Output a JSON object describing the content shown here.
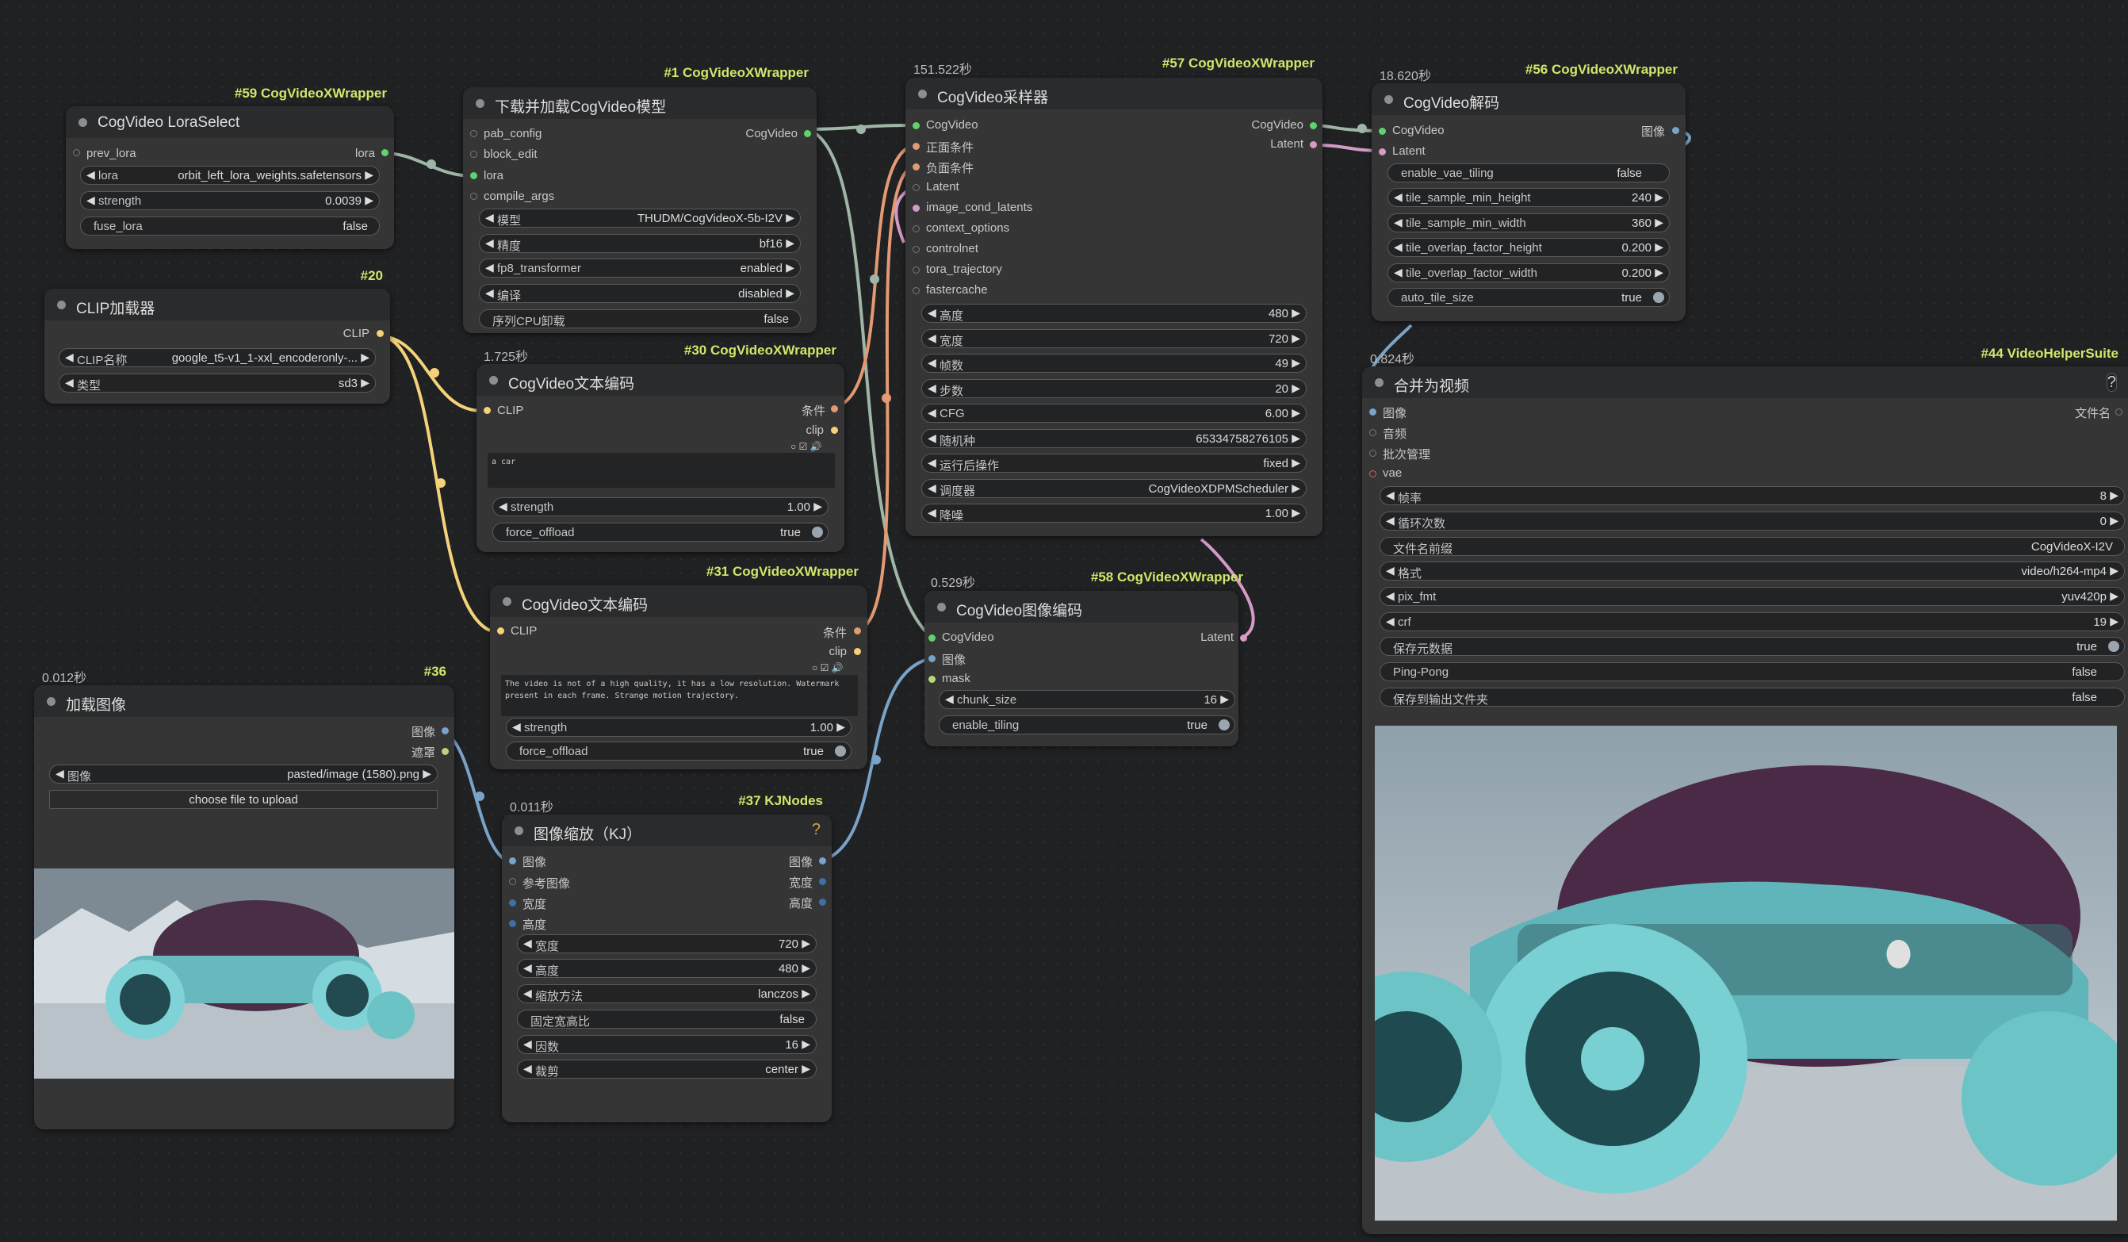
{
  "nodes": {
    "lora_select": {
      "tag": "#59 CogVideoXWrapper",
      "title": "CogVideo LoraSelect",
      "in_prev_lora": "prev_lora",
      "out_lora": "lora",
      "w_lora_label": "lora",
      "w_lora_value": "orbit_left_lora_weights.safetensors",
      "w_strength_label": "strength",
      "w_strength_value": "0.0039",
      "w_fuse_label": "fuse_lora",
      "w_fuse_value": "false"
    },
    "clip_loader": {
      "tag": "#20",
      "title": "CLIP加载器",
      "out_clip": "CLIP",
      "w_clipname_label": "CLIP名称",
      "w_clipname_value": "google_t5-v1_1-xxl_encoderonly-...",
      "w_type_label": "类型",
      "w_type_value": "sd3"
    },
    "download_model": {
      "tag": "#1 CogVideoXWrapper",
      "title": "下载并加载CogVideo模型",
      "in_pab": "pab_config",
      "in_block": "block_edit",
      "in_lora": "lora",
      "in_compile": "compile_args",
      "out_cogvideo": "CogVideo",
      "w_model_label": "模型",
      "w_model_value": "THUDM/CogVideoX-5b-I2V",
      "w_precision_label": "精度",
      "w_precision_value": "bf16",
      "w_fp8_label": "fp8_transformer",
      "w_fp8_value": "enabled",
      "w_compile_label": "编译",
      "w_compile_value": "disabled",
      "w_offload_label": "序列CPU卸载",
      "w_offload_value": "false"
    },
    "text_encode_1": {
      "time": "1.725秒",
      "tag": "#30 CogVideoXWrapper",
      "title": "CogVideo文本编码",
      "in_clip": "CLIP",
      "out_cond": "条件",
      "out_clip": "clip",
      "prompt": "a car",
      "w_strength_label": "strength",
      "w_strength_value": "1.00",
      "w_offload_label": "force_offload",
      "w_offload_value": "true"
    },
    "text_encode_2": {
      "tag": "#31 CogVideoXWrapper",
      "title": "CogVideo文本编码",
      "in_clip": "CLIP",
      "out_cond": "条件",
      "out_clip": "clip",
      "prompt": "The video is not of a high quality, it has a low resolution. Watermark present in each frame. Strange motion trajectory.",
      "w_strength_label": "strength",
      "w_strength_value": "1.00",
      "w_offload_label": "force_offload",
      "w_offload_value": "true"
    },
    "load_image": {
      "time": "0.012秒",
      "tag": "#36",
      "title": "加载图像",
      "out_image": "图像",
      "out_mask": "遮罩",
      "w_image_label": "图像",
      "w_image_value": "pasted/image (1580).png",
      "upload_label": "choose file to upload"
    },
    "image_scale": {
      "time": "0.011秒",
      "tag": "#37 KJNodes",
      "title": "图像缩放（KJ）",
      "help": "?",
      "in_image": "图像",
      "in_ref": "参考图像",
      "in_width": "宽度",
      "in_height": "高度",
      "out_image": "图像",
      "out_width": "宽度",
      "out_height": "高度",
      "w_width_label": "宽度",
      "w_width_value": "720",
      "w_height_label": "高度",
      "w_height_value": "480",
      "w_method_label": "缩放方法",
      "w_method_value": "lanczos",
      "w_keep_label": "固定宽高比",
      "w_keep_value": "false",
      "w_div_label": "因数",
      "w_div_value": "16",
      "w_crop_label": "裁剪",
      "w_crop_value": "center"
    },
    "sampler": {
      "time": "151.522秒",
      "tag": "#57 CogVideoXWrapper",
      "title": "CogVideo采样器",
      "in_cogvideo": "CogVideo",
      "in_pos": "正面条件",
      "in_neg": "负面条件",
      "in_latent": "Latent",
      "in_imgcond": "image_cond_latents",
      "in_context": "context_options",
      "in_controlnet": "controlnet",
      "in_tora": "tora_trajectory",
      "in_fastcache": "fastercache",
      "out_cogvideo": "CogVideo",
      "out_latent": "Latent",
      "w_height_label": "高度",
      "w_height_value": "480",
      "w_width_label": "宽度",
      "w_width_value": "720",
      "w_frames_label": "帧数",
      "w_frames_value": "49",
      "w_steps_label": "步数",
      "w_steps_value": "20",
      "w_cfg_label": "CFG",
      "w_cfg_value": "6.00",
      "w_seed_label": "随机种",
      "w_seed_value": "65334758276105",
      "w_after_label": "运行后操作",
      "w_after_value": "fixed",
      "w_sched_label": "调度器",
      "w_sched_value": "CogVideoXDPMScheduler",
      "w_denoise_label": "降噪",
      "w_denoise_value": "1.00"
    },
    "image_encode": {
      "time": "0.529秒",
      "tag": "#58 CogVideoXWrapper",
      "title": "CogVideo图像编码",
      "in_cogvideo": "CogVideo",
      "in_image": "图像",
      "in_mask": "mask",
      "out_latent": "Latent",
      "w_chunk_label": "chunk_size",
      "w_chunk_value": "16",
      "w_tiling_label": "enable_tiling",
      "w_tiling_value": "true"
    },
    "decode": {
      "time": "18.620秒",
      "tag": "#56 CogVideoXWrapper",
      "title": "CogVideo解码",
      "in_cogvideo": "CogVideo",
      "in_latent": "Latent",
      "out_image": "图像",
      "w_vae_label": "enable_vae_tiling",
      "w_vae_value": "false",
      "w_tsh_label": "tile_sample_min_height",
      "w_tsh_value": "240",
      "w_tsw_label": "tile_sample_min_width",
      "w_tsw_value": "360",
      "w_toh_label": "tile_overlap_factor_height",
      "w_toh_value": "0.200",
      "w_tow_label": "tile_overlap_factor_width",
      "w_tow_value": "0.200",
      "w_auto_label": "auto_tile_size",
      "w_auto_value": "true"
    },
    "video_combine": {
      "time": "0.824秒",
      "tag": "#44 VideoHelperSuite",
      "title": "合并为视频",
      "help": "?",
      "in_images": "图像",
      "in_audio": "音频",
      "in_batch": "批次管理",
      "in_vae": "vae",
      "out_filenames": "文件名",
      "w_fps_label": "帧率",
      "w_fps_value": "8",
      "w_loop_label": "循环次数",
      "w_loop_value": "0",
      "w_prefix_label": "文件名前缀",
      "w_prefix_value": "CogVideoX-I2V",
      "w_format_label": "格式",
      "w_format_value": "video/h264-mp4",
      "w_pix_label": "pix_fmt",
      "w_pix_value": "yuv420p",
      "w_crf_label": "crf",
      "w_crf_value": "19",
      "w_meta_label": "保存元数据",
      "w_meta_value": "true",
      "w_ping_label": "Ping-Pong",
      "w_ping_value": "false",
      "w_save_label": "保存到输出文件夹",
      "w_save_value": "false"
    }
  },
  "colors": {
    "canvas": "#202123",
    "node_body": "#353535",
    "node_header": "#2a2b2d",
    "tag": "#cfe76a",
    "link_clip": "#f5d27a",
    "link_model": "#9fb5a6",
    "link_cond": "#e39a74",
    "link_image": "#7aa3c8",
    "link_latent": "#d59ac6"
  }
}
